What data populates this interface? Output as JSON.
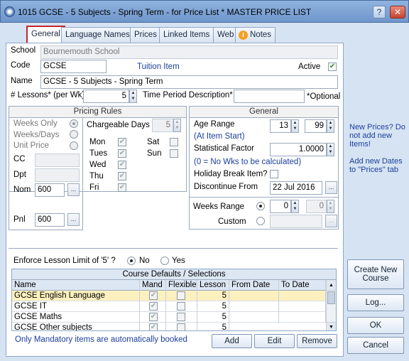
{
  "window": {
    "title": "1015 GCSE - 5 Subjects - Spring Term - for Price List * MASTER PRICE LIST",
    "help": "?",
    "close": "✕"
  },
  "tabs": [
    "General",
    "Language Names",
    "Prices",
    "Linked Items",
    "Web",
    "Notes"
  ],
  "form": {
    "school_label": "School",
    "school_value": "Bournemouth School",
    "code_label": "Code",
    "code_value": "GCSE",
    "tuition_item": "Tuition Item",
    "active_label": "Active",
    "name_label": "Name",
    "name_value": "GCSE - 5 Subjects - Spring Term",
    "lessons_label": "# Lessons* (per Wk)",
    "lessons_value": "5",
    "period_label": "Time Period Description*",
    "optional": "*Optional"
  },
  "pricing": {
    "title": "Pricing Rules",
    "weeks_only": "Weeks Only",
    "weeks_days": "Weeks/Days",
    "unit_price": "Unit Price",
    "chargeable_days": "Chargeable Days",
    "chargeable_value": "5",
    "days": [
      "Mon",
      "Tues",
      "Wed",
      "Thu",
      "Fri",
      "Sat",
      "Sun"
    ],
    "cc": "CC",
    "dpt": "Dpt",
    "nom": "Nom",
    "nom_value": "600",
    "pnl": "Pnl",
    "pnl_value": "600",
    "ellipsis": "..."
  },
  "general": {
    "title": "General",
    "age_range": "Age Range",
    "age_from": "13",
    "age_to": "99",
    "at_item_start": "(At Item Start)",
    "stat_factor": "Statistical Factor",
    "stat_value": "1.0000",
    "stat_note": "(0 = No  Wks to be calculated)",
    "holiday": "Holiday Break Item?",
    "discontinue": "Discontinue From",
    "discontinue_value": "22 Jul 2016",
    "weeks_range": "Weeks Range",
    "weeks_from": "0",
    "weeks_to": "0",
    "custom": "Custom"
  },
  "side_notes": {
    "new_prices": "New Prices? Do not add new Items!",
    "add_dates": "Add new Dates to \"Prices\" tab"
  },
  "enforce": {
    "label": "Enforce Lesson Limit of '5' ?",
    "no": "No",
    "yes": "Yes"
  },
  "course_defaults": {
    "title": "Course Defaults / Selections",
    "columns": [
      "Name",
      "Mand",
      "Flexible",
      "Lesson",
      "From Date",
      "To Date"
    ],
    "rows": [
      {
        "name": "GCSE English Language",
        "lesson": "5"
      },
      {
        "name": "GCSE IT",
        "lesson": "5"
      },
      {
        "name": "GCSE Maths",
        "lesson": "5"
      },
      {
        "name": "GCSE Other subjects",
        "lesson": "5"
      }
    ],
    "footer": "Only Mandatory items are automatically booked",
    "add": "Add",
    "edit": "Edit",
    "remove": "Remove"
  },
  "right_buttons": {
    "create_new_course": "Create New Course",
    "log": "Log...",
    "ok": "OK",
    "cancel": "Cancel"
  }
}
